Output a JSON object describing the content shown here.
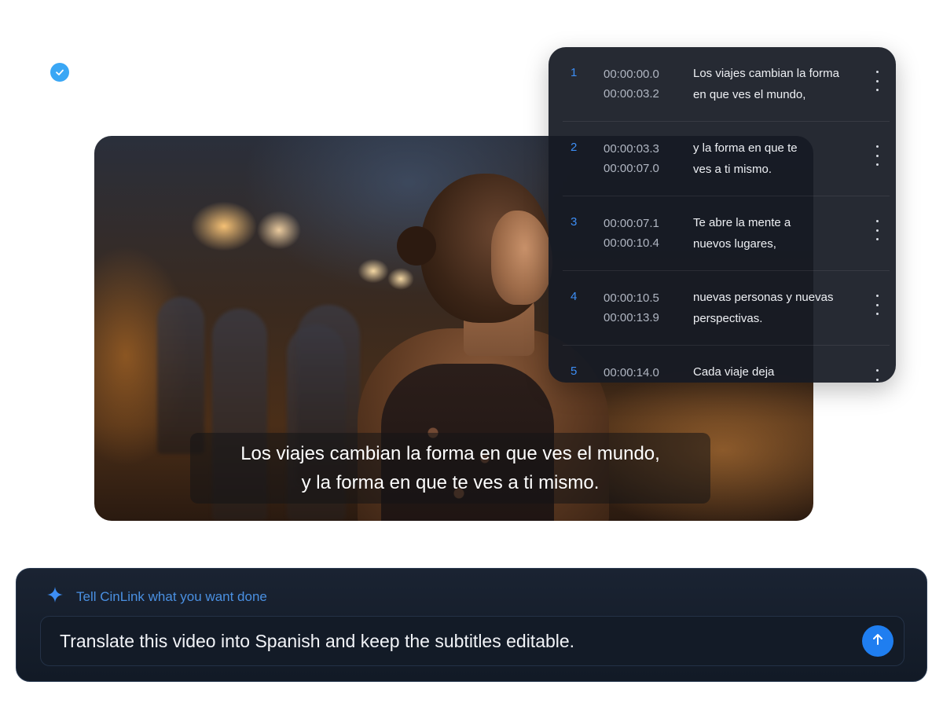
{
  "status": {
    "check_icon": "check-circle-icon",
    "color": "#3aa7f5"
  },
  "video": {
    "subtitle_lines": [
      "Los viajes cambian la forma en que ves el mundo,",
      "y la forma en que te ves a ti mismo."
    ]
  },
  "subtitles": [
    {
      "index": "1",
      "start": "00:00:00.0",
      "end": "00:00:03.2",
      "lines": [
        "Los viajes cambian la forma",
        "en que ves el mundo,"
      ]
    },
    {
      "index": "2",
      "start": "00:00:03.3",
      "end": "00:00:07.0",
      "lines": [
        "y la forma en que te",
        "ves a ti mismo."
      ]
    },
    {
      "index": "3",
      "start": "00:00:07.1",
      "end": "00:00:10.4",
      "lines": [
        "Te abre la mente a",
        "nuevos lugares,"
      ]
    },
    {
      "index": "4",
      "start": "00:00:10.5",
      "end": "00:00:13.9",
      "lines": [
        "nuevas personas y nuevas",
        "perspectivas."
      ]
    },
    {
      "index": "5",
      "start": "00:00:14.0",
      "end": "",
      "lines": [
        "Cada viaje deja",
        ""
      ]
    }
  ],
  "prompt": {
    "header_label": "Tell CinLink what you want done",
    "input_value": "Translate this video into Spanish and keep the subtitles editable.",
    "send_icon": "arrow-up-icon",
    "accent": "#1f7ef0"
  }
}
